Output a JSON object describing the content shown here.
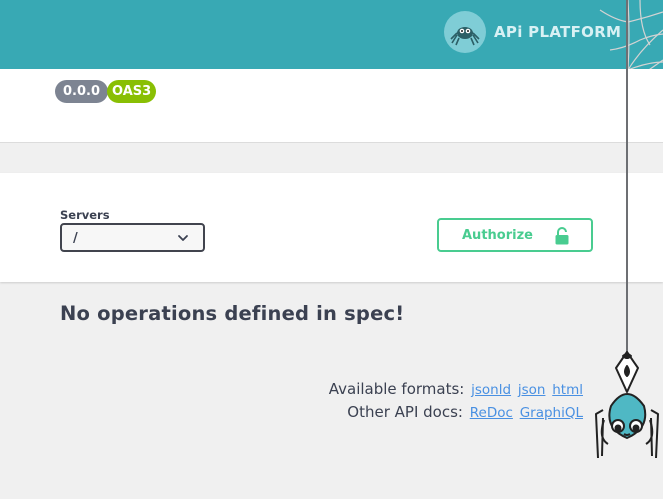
{
  "header": {
    "logo_text": "APi PLATFORM"
  },
  "info": {
    "version": "0.0.0",
    "oas_badge": "OAS3"
  },
  "servers": {
    "label": "Servers",
    "selected": "/"
  },
  "authorize": {
    "label": "Authorize"
  },
  "main": {
    "empty_message": "No operations defined in spec!"
  },
  "formats": {
    "available_label": "Available formats:",
    "available": [
      "jsonld",
      "json",
      "html"
    ],
    "other_label": "Other API docs:",
    "other": [
      "ReDoc",
      "GraphiQL"
    ]
  },
  "colors": {
    "topbar": "#38a9b4",
    "accent_green": "#49cc90",
    "oas_green": "#89bf04",
    "version_gray": "#7d8492",
    "link": "#4990e2",
    "spider_body": "#4fb8c4"
  },
  "icons": [
    "api-platform-spider-logo-icon",
    "chevron-down-icon",
    "lock-icon",
    "spider-icon",
    "spider-web-decoration"
  ]
}
